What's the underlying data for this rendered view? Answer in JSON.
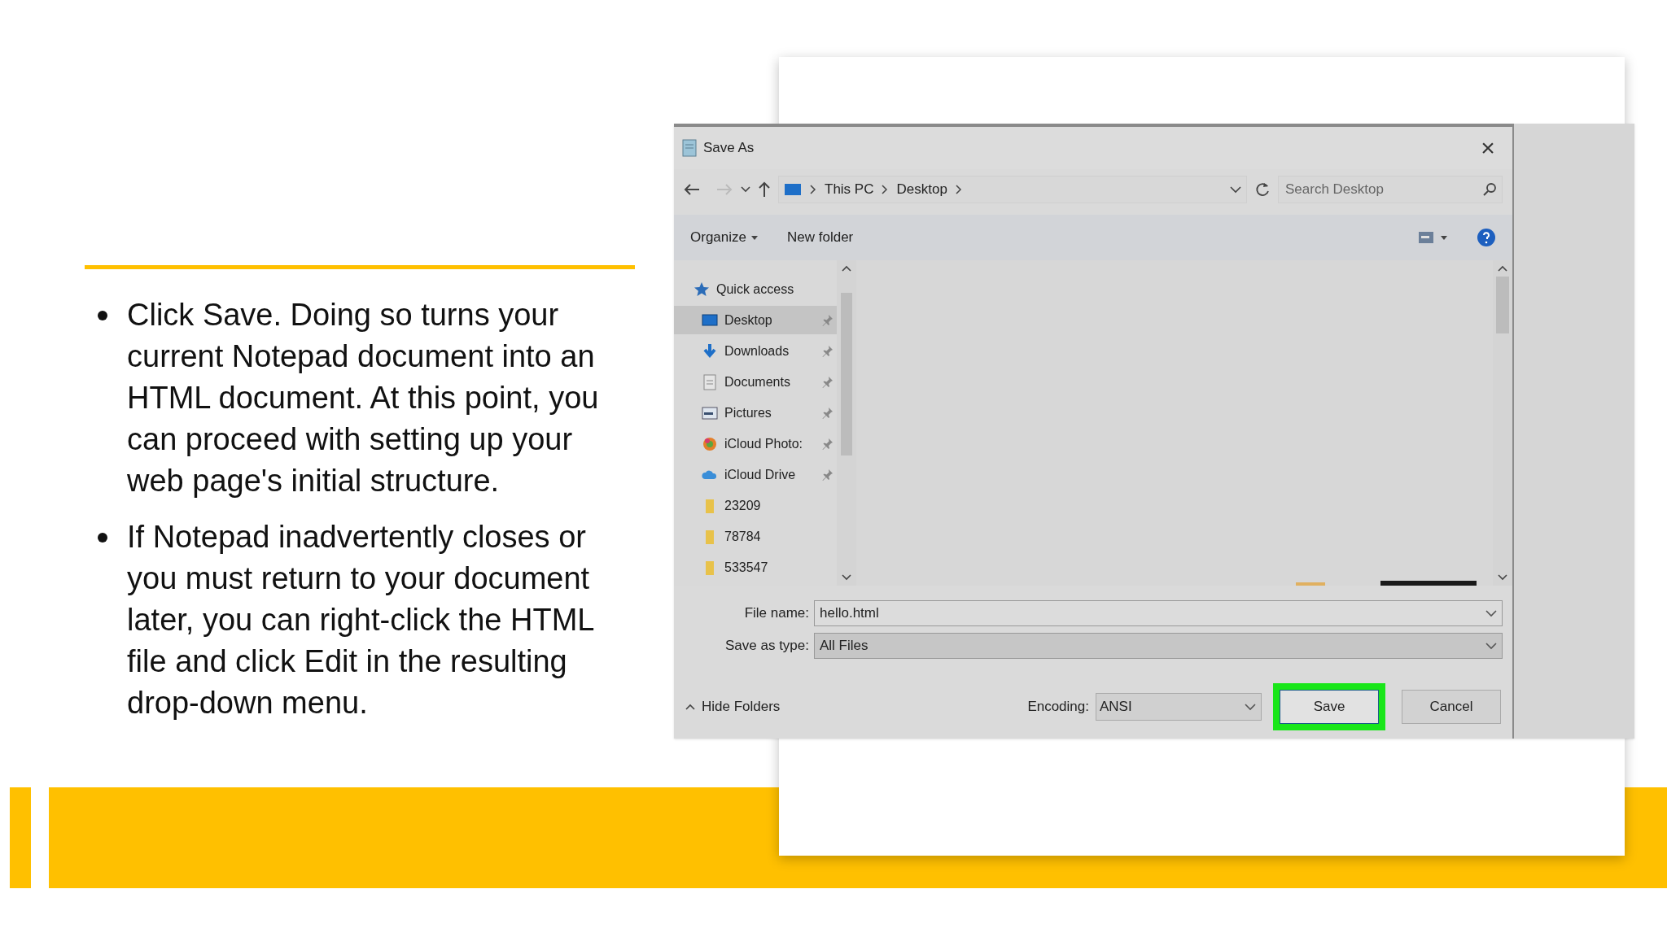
{
  "slide": {
    "bullets": [
      "Click Save. Doing so turns your current Notepad document into an HTML document. At this point, you can proceed with setting up your web page's initial structure.",
      "If Notepad inadvertently closes or you must return to your document later, you can right-click the HTML file and click Edit in the resulting drop-down menu."
    ]
  },
  "dialog": {
    "title": "Save As",
    "close": "×",
    "path": [
      "This PC",
      "Desktop"
    ],
    "search": {
      "placeholder": "Search Desktop"
    },
    "toolbar": {
      "organize": "Organize",
      "new_folder": "New folder"
    },
    "nav": [
      {
        "label": "Quick access",
        "kind": "star",
        "selected": false,
        "pinned": false,
        "children": [
          {
            "label": "Desktop",
            "kind": "desktop",
            "selected": true,
            "pinned": true
          },
          {
            "label": "Downloads",
            "kind": "download",
            "selected": false,
            "pinned": true
          },
          {
            "label": "Documents",
            "kind": "document",
            "selected": false,
            "pinned": true
          },
          {
            "label": "Pictures",
            "kind": "pictures",
            "selected": false,
            "pinned": true
          },
          {
            "label": "iCloud Photo:",
            "kind": "photos",
            "selected": false,
            "pinned": true
          },
          {
            "label": "iCloud Drive",
            "kind": "cloud",
            "selected": false,
            "pinned": true
          },
          {
            "label": "23209",
            "kind": "folder",
            "selected": false,
            "pinned": false
          },
          {
            "label": "78784",
            "kind": "folder",
            "selected": false,
            "pinned": false
          },
          {
            "label": "533547",
            "kind": "folder",
            "selected": false,
            "pinned": false
          }
        ]
      }
    ],
    "file_name": {
      "label": "File name:",
      "value": "hello.html"
    },
    "save_as_type": {
      "label": "Save as type:",
      "value": "All Files"
    },
    "hide_folders": "Hide Folders",
    "encoding": {
      "label": "Encoding:",
      "value": "ANSI"
    },
    "buttons": [
      {
        "label": "Save",
        "highlighted": true
      },
      {
        "label": "Cancel",
        "highlighted": false
      }
    ]
  }
}
